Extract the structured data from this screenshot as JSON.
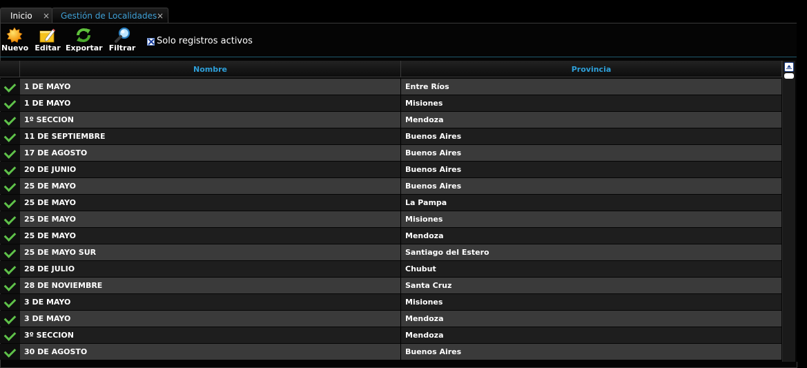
{
  "tabs": [
    {
      "label": "Inicio",
      "close": "×"
    },
    {
      "label": "Gestión de Localidades",
      "close": "×"
    }
  ],
  "toolbar": {
    "nuevo": "Nuevo",
    "editar": "Editar",
    "exportar": "Exportar",
    "filtrar": "Filtrar",
    "checkbox_label": "Solo registros activos",
    "checkbox_checked": true
  },
  "grid": {
    "headers": {
      "nombre": "Nombre",
      "provincia": "Provincia"
    },
    "rows": [
      {
        "nombre": "1 DE MAYO",
        "provincia": "Entre Ríos"
      },
      {
        "nombre": "1 DE MAYO",
        "provincia": "Misiones"
      },
      {
        "nombre": "1º SECCION",
        "provincia": "Mendoza"
      },
      {
        "nombre": "11 DE SEPTIEMBRE",
        "provincia": "Buenos Aires"
      },
      {
        "nombre": "17 DE AGOSTO",
        "provincia": "Buenos Aires"
      },
      {
        "nombre": "20 DE JUNIO",
        "provincia": "Buenos Aires"
      },
      {
        "nombre": "25 DE MAYO",
        "provincia": "Buenos Aires"
      },
      {
        "nombre": "25 DE MAYO",
        "provincia": "La Pampa"
      },
      {
        "nombre": "25 DE MAYO",
        "provincia": "Misiones"
      },
      {
        "nombre": "25 DE MAYO",
        "provincia": "Mendoza"
      },
      {
        "nombre": "25 DE MAYO SUR",
        "provincia": "Santiago del Estero"
      },
      {
        "nombre": "28 DE JULIO",
        "provincia": "Chubut"
      },
      {
        "nombre": "28 DE NOVIEMBRE",
        "provincia": "Santa Cruz"
      },
      {
        "nombre": "3 DE MAYO",
        "provincia": "Misiones"
      },
      {
        "nombre": "3 DE MAYO",
        "provincia": "Mendoza"
      },
      {
        "nombre": "3º SECCION",
        "provincia": "Mendoza"
      },
      {
        "nombre": "30 DE AGOSTO",
        "provincia": "Buenos Aires"
      }
    ]
  },
  "colors": {
    "accent": "#2e9fd8",
    "check": "#5fc24a",
    "row_odd": "#3a3a3a",
    "row_even": "#1e1e1e"
  }
}
